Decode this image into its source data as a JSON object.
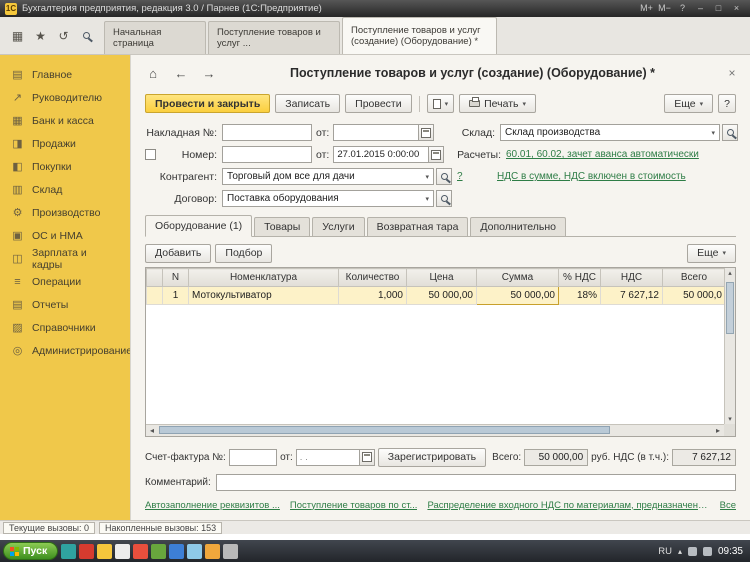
{
  "titlebar": {
    "app_icon_label": "1С",
    "title": "Бухгалтерия предприятия, редакция 3.0 / Парнев (1С:Предприятие)",
    "controls": [
      "М+",
      "М−",
      "?",
      "–",
      "□",
      "×"
    ]
  },
  "topbar": {
    "tabs": [
      {
        "label": "Начальная страница"
      },
      {
        "label": "Поступление товаров и услуг ..."
      },
      {
        "label": "Поступление товаров и услуг (создание) (Оборудование) *"
      }
    ]
  },
  "sidebar": {
    "items": [
      "Главное",
      "Руководителю",
      "Банк и касса",
      "Продажи",
      "Покупки",
      "Склад",
      "Производство",
      "ОС и НМА",
      "Зарплата и кадры",
      "Операции",
      "Отчеты",
      "Справочники",
      "Администрирование"
    ]
  },
  "doc": {
    "title": "Поступление товаров и услуг (создание) (Оборудование) *",
    "toolbar": {
      "post_and_close": "Провести и закрыть",
      "save": "Записать",
      "post": "Провести",
      "print": "Печать",
      "more": "Еще",
      "help": "?"
    },
    "fields": {
      "invoice_no_label": "Накладная №:",
      "from_label": "от:",
      "warehouse_label": "Склад:",
      "warehouse_value": "Склад производства",
      "number_label": "Номер:",
      "number_date_value": "27.01.2015  0:00:00",
      "settlements_label": "Расчеты:",
      "settlements_link": "60.01, 60.02, зачет аванса автоматически",
      "counterparty_label": "Контрагент:",
      "counterparty_value": "Торговый дом все для дачи",
      "counterparty_help": "?",
      "vat_link": "НДС в сумме, НДС включен в стоимость",
      "contract_label": "Договор:",
      "contract_value": "Поставка оборудования"
    },
    "item_tabs": [
      "Оборудование (1)",
      "Товары",
      "Услуги",
      "Возвратная тара",
      "Дополнительно"
    ],
    "grid_toolbar": {
      "add": "Добавить",
      "pick": "Подбор",
      "more": "Еще"
    },
    "table": {
      "columns": [
        "N",
        "Номенклатура",
        "Количество",
        "Цена",
        "Сумма",
        "% НДС",
        "НДС",
        "Всего"
      ],
      "rows": [
        [
          "1",
          "Мотокультиватор",
          "1,000",
          "50 000,00",
          "50 000,00",
          "18%",
          "7 627,12",
          "50 000,0"
        ]
      ]
    },
    "footer": {
      "invoice_label": "Счет-фактура №:",
      "invoice_date_placeholder": ".  .",
      "register": "Зарегистрировать",
      "total_label": "Всего:",
      "total_value": "50 000,00",
      "currency": "руб.",
      "vat_label": "НДС (в т.ч.):",
      "vat_value": "7 627,12",
      "comment_label": "Комментарий:"
    },
    "links": {
      "link1": "Автозаполнение реквизитов ...",
      "link2": "Поступление товаров по ст...",
      "link3": "Распределение входного НДС по материалам, предназначенным для облаг...",
      "all": "Все"
    }
  },
  "statusbar": {
    "current_calls": "Текущие вызовы: 0",
    "accumulated_calls": "Накопленные вызовы: 153"
  },
  "taskbar": {
    "start": "Пуск",
    "lang": "RU",
    "time": "09:35"
  },
  "colors": {
    "accent_yellow": "#f0c84a",
    "selection_yellow": "#ffd84f",
    "link_green": "#2e7d46"
  }
}
